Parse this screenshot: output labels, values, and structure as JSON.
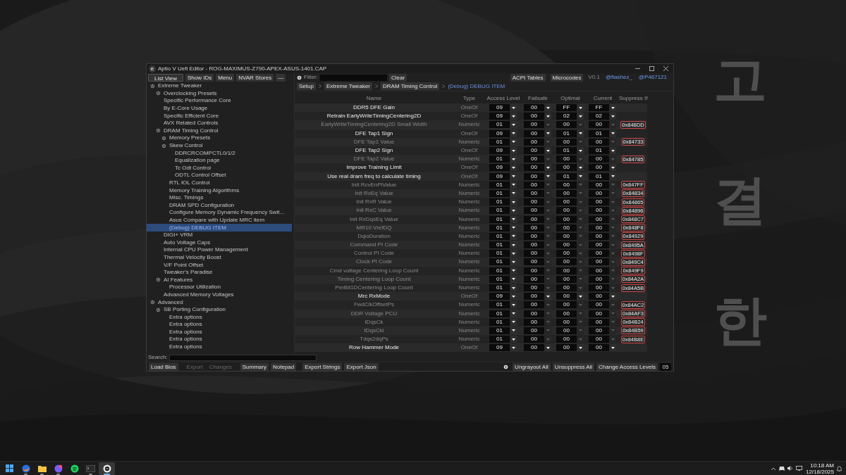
{
  "wallpaper": {
    "characters": [
      "고",
      "결",
      "한"
    ]
  },
  "window": {
    "title": "Aptio V Uefi Editor - ROG-MAXIMUS-Z790-APEX-ASUS-1401.CAP",
    "app_icon": "e"
  },
  "toolbar": {
    "buttons": [
      {
        "label": "List View",
        "selected": true
      },
      {
        "label": "Show IDs",
        "selected": false
      },
      {
        "label": "Menu",
        "selected": false
      },
      {
        "label": "NVAR Stores",
        "selected": false
      },
      {
        "label": "—",
        "selected": false
      }
    ],
    "filter": {
      "label": "Filter:",
      "clear": "Clear"
    },
    "right_buttons": [
      "ACPI Tables",
      "Microcodes"
    ],
    "version": "V0.1",
    "links": [
      "@flashez_",
      "@P467121"
    ]
  },
  "sidebar": {
    "items": [
      {
        "label": "Extreme Tweaker",
        "expandable": true,
        "selected": false,
        "children": [
          {
            "label": "Overclocking Presets",
            "expandable": true,
            "selected": false
          },
          {
            "label": "Specific Performance Core",
            "expandable": false,
            "selected": false
          },
          {
            "label": "By E-Core Usage",
            "expandable": false,
            "selected": false
          },
          {
            "label": "Specific Efficient Core",
            "expandable": false,
            "selected": false
          },
          {
            "label": "AVX Related Controls",
            "expandable": false,
            "selected": false
          },
          {
            "label": "DRAM Timing Control",
            "expandable": true,
            "selected": false,
            "children": [
              {
                "label": "Memory Presets",
                "expandable": true,
                "selected": false
              },
              {
                "label": "Skew Control",
                "expandable": true,
                "selected": false,
                "children": [
                  {
                    "label": "DDRCRCOMPCTL0/1/2",
                    "expandable": false,
                    "selected": false
                  },
                  {
                    "label": "Equalization page",
                    "expandable": false,
                    "selected": false
                  },
                  {
                    "label": "Tc Odt Control",
                    "expandable": false,
                    "selected": false
                  },
                  {
                    "label": "ODTL Control Offset",
                    "expandable": false,
                    "selected": false
                  }
                ]
              },
              {
                "label": "RTL IOL Control",
                "expandable": false,
                "selected": false
              },
              {
                "label": "Memory Training Algorithms",
                "expandable": false,
                "selected": false
              },
              {
                "label": "Misc. Timings",
                "expandable": false,
                "selected": false
              },
              {
                "label": "DRAM SPD Configuration",
                "expandable": false,
                "selected": false
              },
              {
                "label": "Configure Memory Dynamic Frequency Swit...",
                "expandable": false,
                "selected": false
              },
              {
                "label": "Asus Compare with Update MRC item",
                "expandable": false,
                "selected": false
              },
              {
                "label": "(Debug) DEBUG ITEM",
                "expandable": false,
                "selected": true
              }
            ]
          },
          {
            "label": "DIGI+ VRM",
            "expandable": false,
            "selected": false
          },
          {
            "label": "Auto Voltage Caps",
            "expandable": false,
            "selected": false
          },
          {
            "label": "Internal CPU Power Management",
            "expandable": false,
            "selected": false
          },
          {
            "label": "Thermal Velocity Boost",
            "expandable": false,
            "selected": false
          },
          {
            "label": "V/F Point Offset",
            "expandable": false,
            "selected": false
          },
          {
            "label": "Tweaker's Paradise",
            "expandable": false,
            "selected": false
          },
          {
            "label": "AI Features",
            "expandable": true,
            "selected": false,
            "children": [
              {
                "label": "Processor Utilization",
                "expandable": false,
                "selected": false
              }
            ]
          },
          {
            "label": "Advanced Memory Voltages",
            "expandable": false,
            "selected": false
          }
        ]
      },
      {
        "label": "Advanced",
        "expandable": true,
        "selected": false,
        "children": [
          {
            "label": "SB Porting Configuration",
            "expandable": true,
            "selected": false,
            "children": [
              {
                "label": "Extra options",
                "expandable": false,
                "selected": false
              },
              {
                "label": "Extra options",
                "expandable": false,
                "selected": false
              },
              {
                "label": "Extra options",
                "expandable": false,
                "selected": false
              },
              {
                "label": "Extra options",
                "expandable": false,
                "selected": false
              },
              {
                "label": "Extra options",
                "expandable": false,
                "selected": false
              }
            ]
          }
        ]
      }
    ],
    "search_label": "Search:"
  },
  "breadcrumb": [
    "Setup",
    "Extreme Tweaker",
    "DRAM Timing Control",
    "(Debug) DEBUG ITEM"
  ],
  "table": {
    "columns": [
      "Name",
      "Type",
      "Access Level",
      "Failsafe",
      "Optimal",
      "Current",
      "Suppress If"
    ],
    "rows": [
      {
        "name": "DDR5 DFE Gain",
        "type": "OneOf",
        "access": "09",
        "failsafe": "00",
        "optimal": "FF",
        "current": "FF",
        "grayed": false
      },
      {
        "name": "Retrain EarlyWriteTimingCentering2D",
        "type": "OneOf",
        "access": "09",
        "failsafe": "00",
        "optimal": "02",
        "current": "02",
        "grayed": false
      },
      {
        "name": "EarlyWriteTimingCentering2D Small Width",
        "type": "Numeric",
        "access": "01",
        "failsafe": "00",
        "optimal": "00",
        "current": "00",
        "grayed": true,
        "suppress": "0x846DD"
      },
      {
        "name": "DFE Tap1 Sign",
        "type": "OneOf",
        "access": "09",
        "failsafe": "00",
        "optimal": "01",
        "current": "01",
        "grayed": false
      },
      {
        "name": "DFE Tap1 Value",
        "type": "Numeric",
        "access": "01",
        "failsafe": "00",
        "optimal": "00",
        "current": "00",
        "grayed": true,
        "suppress": "0x84733"
      },
      {
        "name": "DFE Tap2 Sign",
        "type": "OneOf",
        "access": "09",
        "failsafe": "00",
        "optimal": "01",
        "current": "01",
        "grayed": false
      },
      {
        "name": "DFE Tap2 Value",
        "type": "Numeric",
        "access": "01",
        "failsafe": "00",
        "optimal": "00",
        "current": "00",
        "grayed": true,
        "suppress": "0x84785"
      },
      {
        "name": "Improve Training Limit",
        "type": "OneOf",
        "access": "09",
        "failsafe": "00",
        "optimal": "00",
        "current": "00",
        "grayed": false
      },
      {
        "name": "Use real dram freq to calculate timing",
        "type": "OneOf",
        "access": "09",
        "failsafe": "00",
        "optimal": "01",
        "current": "01",
        "grayed": false
      },
      {
        "name": "Init RcvEnPiValue",
        "type": "Numeric",
        "access": "01",
        "failsafe": "00",
        "optimal": "00",
        "current": "00",
        "grayed": true,
        "suppress": "0x847FF"
      },
      {
        "name": "Init RxEq Value",
        "type": "Numeric",
        "access": "01",
        "failsafe": "00",
        "optimal": "00",
        "current": "00",
        "grayed": true,
        "suppress": "0x84834"
      },
      {
        "name": "Init RxR Value",
        "type": "Numeric",
        "access": "01",
        "failsafe": "00",
        "optimal": "00",
        "current": "00",
        "grayed": true,
        "suppress": "0x84865"
      },
      {
        "name": "Init RxC Value",
        "type": "Numeric",
        "access": "01",
        "failsafe": "00",
        "optimal": "00",
        "current": "00",
        "grayed": true,
        "suppress": "0x84896"
      },
      {
        "name": "Init RxDqsEq Value",
        "type": "Numeric",
        "access": "01",
        "failsafe": "00",
        "optimal": "00",
        "current": "00",
        "grayed": true,
        "suppress": "0x848C7"
      },
      {
        "name": "MR10 VrefDQ",
        "type": "Numeric",
        "access": "01",
        "failsafe": "00",
        "optimal": "00",
        "current": "00",
        "grayed": true,
        "suppress": "0x848F8"
      },
      {
        "name": "DqioDuration",
        "type": "Numeric",
        "access": "01",
        "failsafe": "00",
        "optimal": "00",
        "current": "00",
        "grayed": true,
        "suppress": "0x84929"
      },
      {
        "name": "Command PI Code",
        "type": "Numeric",
        "access": "01",
        "failsafe": "00",
        "optimal": "00",
        "current": "00",
        "grayed": true,
        "suppress": "0x8495A"
      },
      {
        "name": "Control PI Code",
        "type": "Numeric",
        "access": "01",
        "failsafe": "00",
        "optimal": "00",
        "current": "00",
        "grayed": true,
        "suppress": "0x8498F"
      },
      {
        "name": "Clock PI Code",
        "type": "Numeric",
        "access": "01",
        "failsafe": "00",
        "optimal": "00",
        "current": "00",
        "grayed": true,
        "suppress": "0x849C4"
      },
      {
        "name": "Cmd voltage Centering Loop Count",
        "type": "Numeric",
        "access": "01",
        "failsafe": "00",
        "optimal": "00",
        "current": "00",
        "grayed": true,
        "suppress": "0x849F9"
      },
      {
        "name": "Timing Centering Loop Count",
        "type": "Numeric",
        "access": "01",
        "failsafe": "00",
        "optimal": "00",
        "current": "00",
        "grayed": true,
        "suppress": "0x84A2A"
      },
      {
        "name": "PerBit1DCentering Loop Count",
        "type": "Numeric",
        "access": "01",
        "failsafe": "00",
        "optimal": "00",
        "current": "00",
        "grayed": true,
        "suppress": "0x84A5B"
      },
      {
        "name": "Mrc RxMode",
        "type": "OneOf",
        "access": "09",
        "failsafe": "00",
        "optimal": "00",
        "current": "00",
        "grayed": false
      },
      {
        "name": "FwdClkOffsetPs",
        "type": "Numeric",
        "access": "01",
        "failsafe": "00",
        "optimal": "00",
        "current": "00",
        "grayed": true,
        "suppress": "0x84AC2"
      },
      {
        "name": "DDR Voltage PCU",
        "type": "Numeric",
        "access": "01",
        "failsafe": "00",
        "optimal": "00",
        "current": "00",
        "grayed": true,
        "suppress": "0x84AF3"
      },
      {
        "name": "tDqsCk",
        "type": "Numeric",
        "access": "01",
        "failsafe": "00",
        "optimal": "00",
        "current": "00",
        "grayed": true,
        "suppress": "0x84B24"
      },
      {
        "name": "tDqsCki",
        "type": "Numeric",
        "access": "01",
        "failsafe": "00",
        "optimal": "00",
        "current": "00",
        "grayed": true,
        "suppress": "0x84B59"
      },
      {
        "name": "Tdqs2dqPs",
        "type": "Numeric",
        "access": "01",
        "failsafe": "00",
        "optimal": "00",
        "current": "00",
        "grayed": true,
        "suppress": "0x84B8E"
      },
      {
        "name": "Row Hammer Mode",
        "type": "OneOf",
        "access": "09",
        "failsafe": "00",
        "optimal": "00",
        "current": "00",
        "grayed": false
      }
    ]
  },
  "bottom_bar": {
    "buttons": [
      {
        "label": "Load Bios",
        "disabled": false
      },
      {
        "label": "Export",
        "disabled": true
      },
      {
        "label": "Changes",
        "disabled": true
      },
      {
        "label": "Summary",
        "disabled": false
      },
      {
        "label": "Notepad",
        "disabled": false
      },
      {
        "label": "Export Strings",
        "disabled": false
      },
      {
        "label": "Export Json",
        "disabled": false
      }
    ],
    "right_buttons": [
      "Ungrayout All",
      "Unsuppress All",
      "Change Access Levels"
    ],
    "access_level": "05"
  },
  "taskbar": {
    "apps": [
      {
        "kind": "start",
        "running": false,
        "selected": false
      },
      {
        "kind": "browser",
        "running": true,
        "selected": false
      },
      {
        "kind": "folder",
        "running": true,
        "selected": false
      },
      {
        "kind": "chat",
        "running": true,
        "selected": false
      },
      {
        "kind": "music",
        "running": false,
        "selected": false
      },
      {
        "kind": "terminal",
        "running": true,
        "selected": false
      },
      {
        "kind": "editor",
        "running": true,
        "selected": true
      }
    ],
    "time": "10:18 AM",
    "date": "12/18/2025"
  }
}
